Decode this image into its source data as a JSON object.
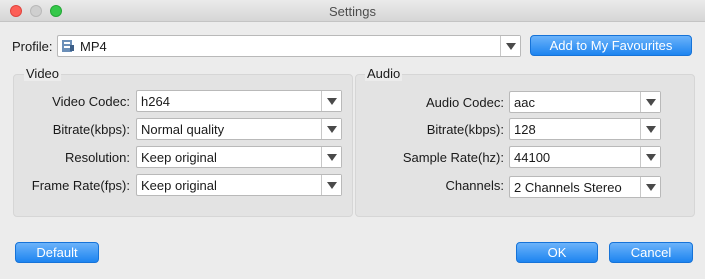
{
  "window": {
    "title": "Settings"
  },
  "profile": {
    "label": "Profile:",
    "value": "MP4",
    "favourites_button": "Add to My Favourites"
  },
  "video": {
    "title": "Video",
    "fields": [
      {
        "label": "Video Codec:",
        "value": "h264"
      },
      {
        "label": "Bitrate(kbps):",
        "value": "Normal quality"
      },
      {
        "label": "Resolution:",
        "value": "Keep original"
      },
      {
        "label": "Frame Rate(fps):",
        "value": "Keep original"
      }
    ]
  },
  "audio": {
    "title": "Audio",
    "fields": [
      {
        "label": "Audio Codec:",
        "value": "aac"
      },
      {
        "label": "Bitrate(kbps):",
        "value": "128"
      },
      {
        "label": "Sample Rate(hz):",
        "value": "44100"
      },
      {
        "label": "Channels:",
        "value": "2 Channels Stereo"
      }
    ]
  },
  "buttons": {
    "default": "Default",
    "ok": "OK",
    "cancel": "Cancel"
  },
  "colors": {
    "accent": "#1d84f0",
    "close": "#fd5f57",
    "maximize": "#35c84a"
  }
}
